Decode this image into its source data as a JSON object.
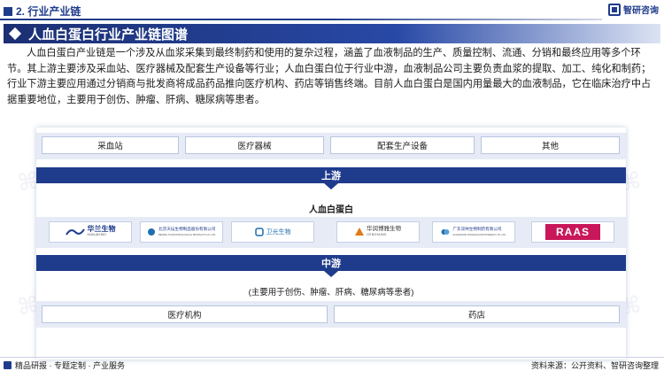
{
  "header": {
    "section_title": "2. 行业产业链",
    "brand_name": "智研咨询"
  },
  "banner": {
    "title": "人血白蛋白行业产业链图谱"
  },
  "intro": {
    "text": "人血白蛋白产业链是一个涉及从血浆采集到最终制药和使用的复杂过程，涵盖了血液制品的生产、质量控制、流通、分销和最终应用等多个环节。其上游主要涉及采血站、医疗器械及配套生产设备等行业；人血白蛋白位于行业中游，血液制品公司主要负责血浆的提取、加工、纯化和制药；行业下游主要应用通过分销商与批发商将成品药品推向医疗机构、药店等销售终端。目前人血白蛋白是国内用量最大的血液制品，它在临床治疗中占据重要地位，主要用于创伤、肿瘤、肝病、糖尿病等患者。"
  },
  "upstream": {
    "items": [
      "采血站",
      "医疗器械",
      "配套生产设备",
      "其他"
    ],
    "label": "上游"
  },
  "midstream": {
    "title": "人血白蛋白",
    "label": "中游",
    "companies": [
      {
        "name": "华兰生物",
        "sub": "HUALAN BIO",
        "icon": "wave-logo-icon",
        "color": "#1f3b8c"
      },
      {
        "name": "北京天坛生物制品股份有限公司",
        "sub": "BEIJING TIANTAN BIOLOGICAL PRODUCTS CO.,LTD.",
        "icon": "tiantan-logo-icon",
        "color": "#1f6fb0"
      },
      {
        "name": "卫光生物",
        "sub": "",
        "icon": "weiguang-logo-icon",
        "color": "#1f6fb0"
      },
      {
        "name": "华润博雅生物",
        "sub": "CR BOYA BIO",
        "icon": "boya-logo-icon",
        "color": "#e07a1a"
      },
      {
        "name": "广东双林生物制药有限公司",
        "sub": "GUANGDONG SHUANGLIN BIO-PHARMACY CO.,LTD.",
        "icon": "shuanglin-logo-icon",
        "color": "#1f6fb0"
      },
      {
        "name": "RAAS",
        "sub": "",
        "icon": "raas-logo-icon",
        "color": "#c8175a"
      }
    ]
  },
  "downstream": {
    "title": "(主要用于创伤、肿瘤、肝病、糖尿病等患者)",
    "items": [
      "医疗机构",
      "药店"
    ]
  },
  "footer": {
    "left": "精品研报 · 专题定制 · 产业服务",
    "right": "资料来源：公开资料、智研咨询整理"
  },
  "colors": {
    "primary": "#1f3b8c",
    "panel_fill": "#e6ebf6"
  }
}
